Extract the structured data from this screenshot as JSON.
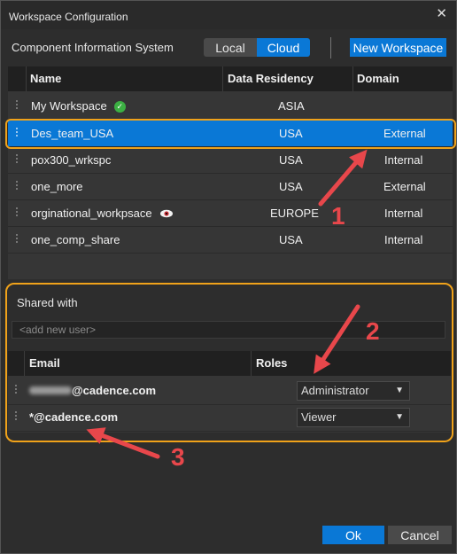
{
  "window": {
    "title": "Workspace Configuration",
    "close_glyph": "✕"
  },
  "toolbar": {
    "system_label": "Component Information System",
    "local_label": "Local",
    "cloud_label": "Cloud",
    "new_workspace_label": "New Workspace"
  },
  "workspaces": {
    "columns": {
      "name": "Name",
      "residency": "Data Residency",
      "domain": "Domain"
    },
    "rows": [
      {
        "name": "My Workspace",
        "residency": "ASIA",
        "domain": "",
        "icon": "check-circle-icon"
      },
      {
        "name": "Des_team_USA",
        "residency": "USA",
        "domain": "External",
        "selected": true
      },
      {
        "name": "pox300_wrkspc",
        "residency": "USA",
        "domain": "Internal"
      },
      {
        "name": "one_more",
        "residency": "USA",
        "domain": "External"
      },
      {
        "name": "orginational_workpsace",
        "residency": "EUROPE",
        "domain": "Internal",
        "icon": "eye-icon"
      },
      {
        "name": "one_comp_share",
        "residency": "USA",
        "domain": "Internal"
      }
    ]
  },
  "shared": {
    "label": "Shared with",
    "add_user_placeholder": "<add new user>",
    "columns": {
      "email": "Email",
      "roles": "Roles"
    },
    "rows": [
      {
        "email": "@cadence.com",
        "role": "Administrator",
        "redacted_prefix": true
      },
      {
        "email": "*@cadence.com",
        "role": "Viewer"
      }
    ]
  },
  "footer": {
    "ok_label": "Ok",
    "cancel_label": "Cancel"
  },
  "annotations": {
    "one": "1",
    "two": "2",
    "three": "3"
  },
  "colors": {
    "accent": "#0a78d6",
    "highlight": "#f0a21a",
    "arrow": "#e8474b",
    "check": "#3cb043"
  }
}
